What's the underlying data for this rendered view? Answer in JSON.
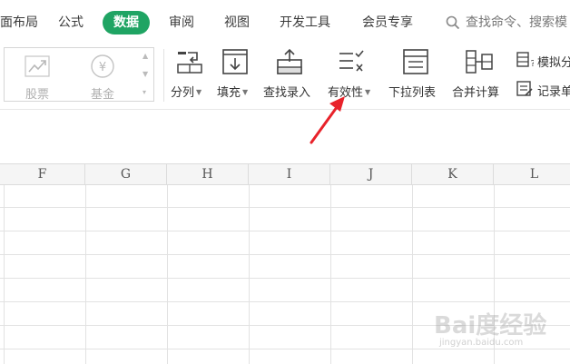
{
  "tabs": [
    {
      "label": "页面布局",
      "shown": "面布局"
    },
    {
      "label": "公式"
    },
    {
      "label": "数据",
      "active": true
    },
    {
      "label": "审阅"
    },
    {
      "label": "视图"
    },
    {
      "label": "开发工具"
    },
    {
      "label": "会员专享"
    }
  ],
  "search": {
    "placeholder": "查找命令、搜索模"
  },
  "gallery": {
    "items": [
      {
        "label": "股票",
        "icon": "stock-chart-icon"
      },
      {
        "label": "基金",
        "icon": "yen-coin-icon"
      }
    ]
  },
  "tools": {
    "split": "分列",
    "fill": "填充",
    "lookup_entry": "查找录入",
    "validity": "有效性",
    "dropdown_list": "下拉列表",
    "consolidate": "合并计算",
    "simulate": "模拟分",
    "record": "记录单"
  },
  "columns": [
    "F",
    "G",
    "H",
    "I",
    "J",
    "K",
    "L"
  ],
  "watermark": {
    "brand": "Bai度经验",
    "url": "jingyan.baidu.com"
  },
  "colors": {
    "accent": "#1fa463",
    "arrow": "#e8222a"
  }
}
